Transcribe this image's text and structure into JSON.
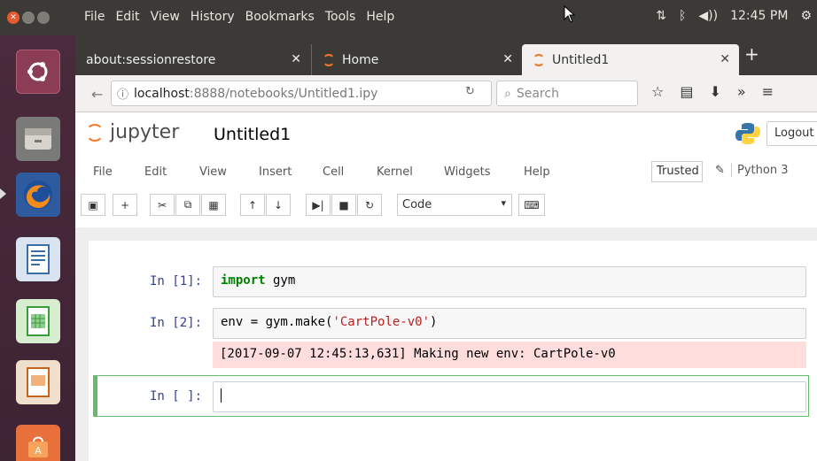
{
  "topbar": {
    "menus": [
      "File",
      "Edit",
      "View",
      "History",
      "Bookmarks",
      "Tools",
      "Help"
    ],
    "time": "12:45 PM"
  },
  "tabs": [
    {
      "label": "about:sessionrestore"
    },
    {
      "label": "Home"
    },
    {
      "label": "Untitled1"
    }
  ],
  "navbar": {
    "url_host": "localhost",
    "url_path": ":8888/notebooks/Untitled1.ipy",
    "search_placeholder": "Search"
  },
  "jupyter": {
    "logo_text": "jupyter",
    "notebook_title": "Untitled1",
    "logout_label": "Logout",
    "menu": [
      "File",
      "Edit",
      "View",
      "Insert",
      "Cell",
      "Kernel",
      "Widgets",
      "Help"
    ],
    "trusted_label": "Trusted",
    "kernel_label": "Python 3",
    "cell_type": "Code"
  },
  "cells": [
    {
      "prompt": "In [1]:",
      "code_kw": "import",
      "code_rest": " gym"
    },
    {
      "prompt": "In [2]:",
      "code_pre": "env = gym.make(",
      "code_str": "'CartPole-v0'",
      "code_post": ")",
      "output": "[2017-09-07 12:45:13,631] Making new env: CartPole-v0"
    },
    {
      "prompt": "In [ ]:"
    }
  ],
  "colors": {
    "jupyter_orange": "#f37726",
    "prompt_blue": "#303f9f",
    "selected_green": "#66bb6a",
    "stderr_pink": "#ffdddd"
  }
}
